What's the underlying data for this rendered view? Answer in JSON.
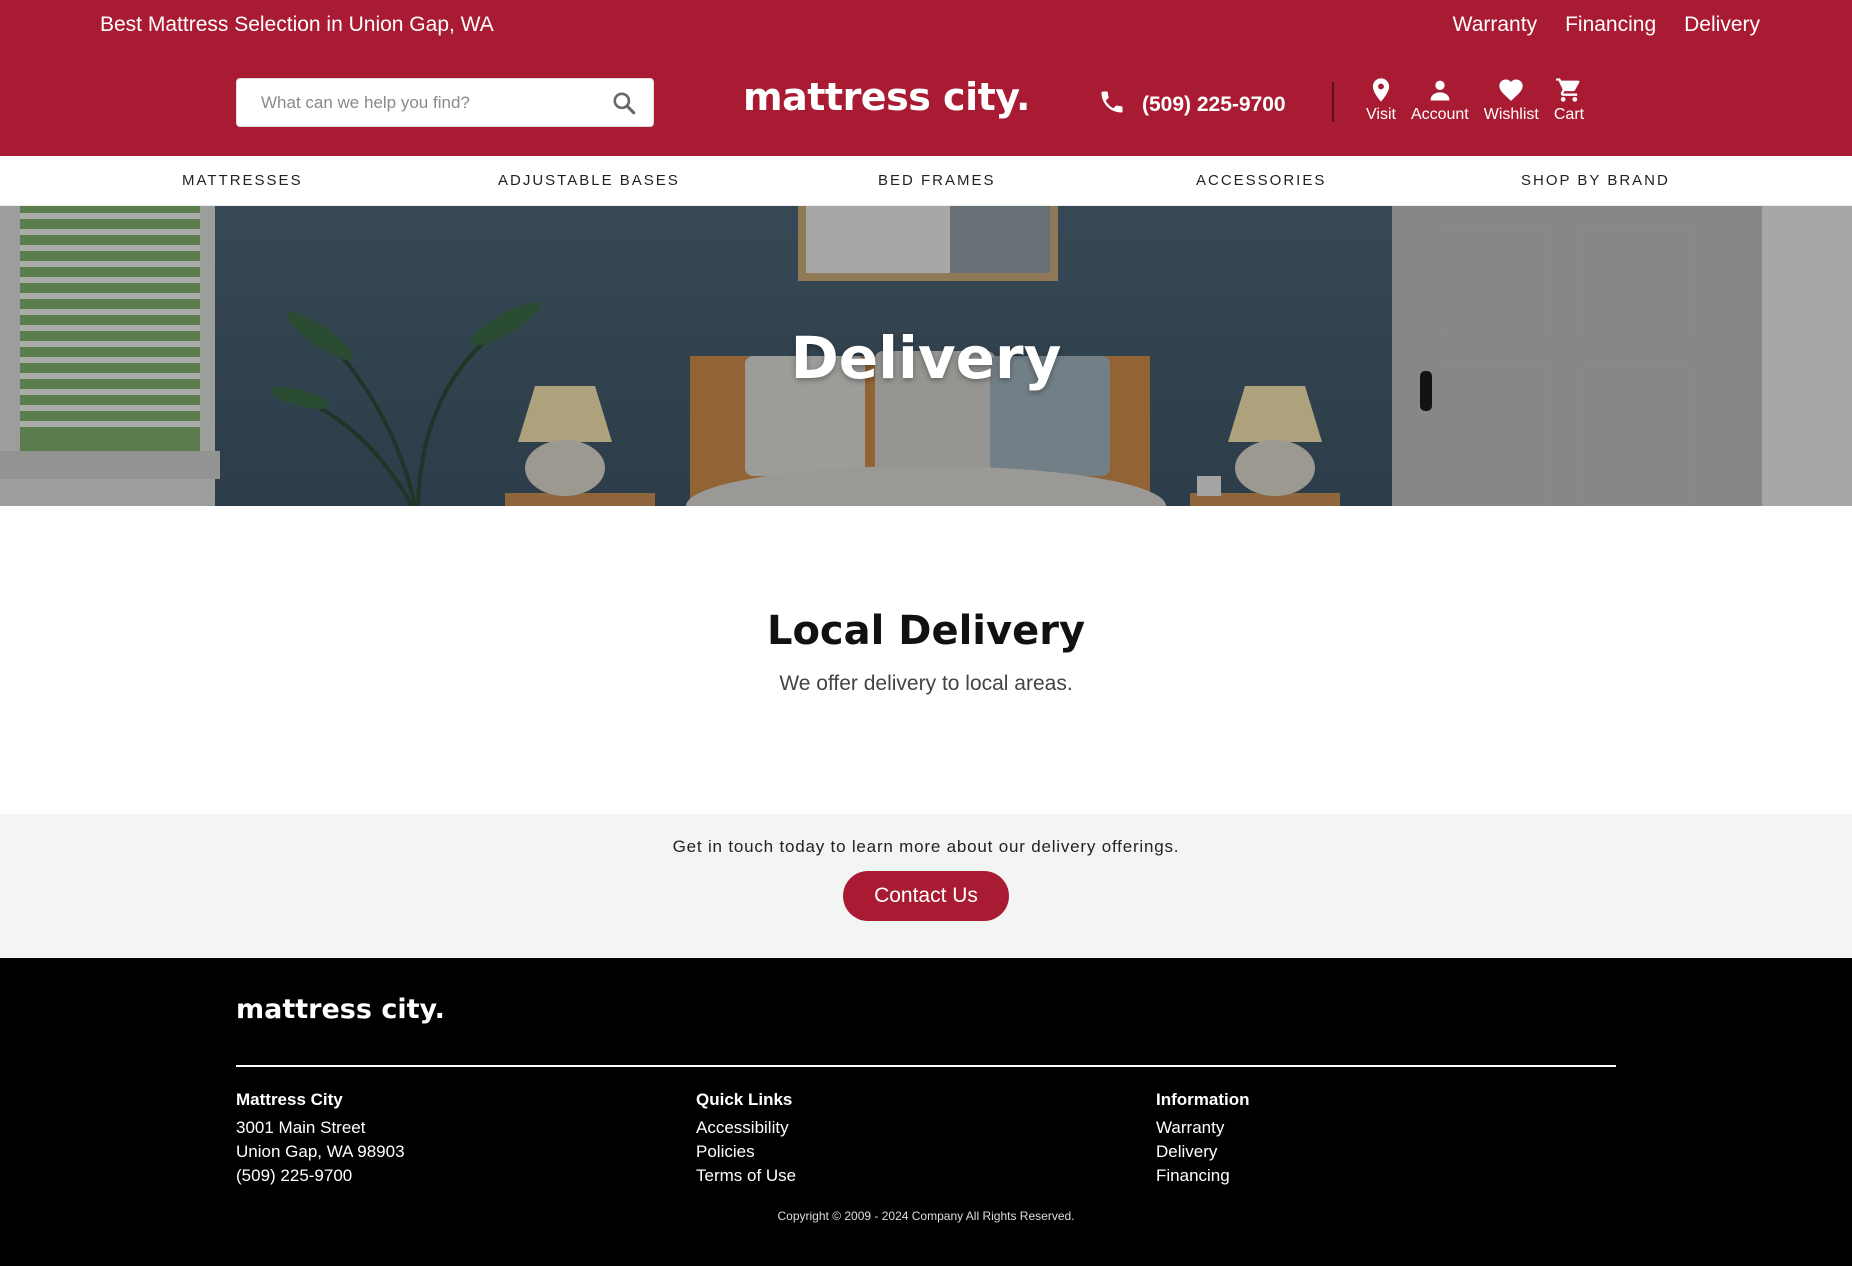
{
  "topbar": {
    "tagline": "Best Mattress Selection in Union Gap, WA",
    "links": [
      "Warranty",
      "Financing",
      "Delivery"
    ]
  },
  "search": {
    "placeholder": "What can we help you find?"
  },
  "brand": {
    "logo": "mattress city."
  },
  "contact": {
    "phone": "(509) 225-9700"
  },
  "icon_nav": [
    {
      "label": "Visit",
      "icon": "location-pin-icon"
    },
    {
      "label": "Account",
      "icon": "person-icon"
    },
    {
      "label": "Wishlist",
      "icon": "heart-icon"
    },
    {
      "label": "Cart",
      "icon": "cart-icon"
    }
  ],
  "main_nav": [
    "MATTRESSES",
    "ADJUSTABLE BASES",
    "BED FRAMES",
    "ACCESSORIES",
    "SHOP BY BRAND"
  ],
  "hero": {
    "title": "Delivery"
  },
  "local_delivery": {
    "heading": "Local Delivery",
    "text": "We offer delivery to local areas."
  },
  "cta": {
    "text": "Get in touch today to learn more about our delivery offerings.",
    "button": "Contact Us"
  },
  "footer": {
    "logo": "mattress city.",
    "company": {
      "heading": "Mattress City",
      "street": "3001 Main Street",
      "city": "Union Gap, WA 98903",
      "phone": "(509) 225-9700"
    },
    "quick_links": {
      "heading": "Quick Links",
      "links": [
        "Accessibility",
        "Policies",
        "Terms of Use"
      ]
    },
    "information": {
      "heading": "Information",
      "links": [
        "Warranty",
        "Delivery",
        "Financing"
      ]
    },
    "copyright": "Copyright © 2009 - 2024 Company All Rights Reserved."
  },
  "colors": {
    "brand": "#a81b32",
    "footer_bg": "#000000",
    "cta_bg": "#f3f4f4"
  }
}
